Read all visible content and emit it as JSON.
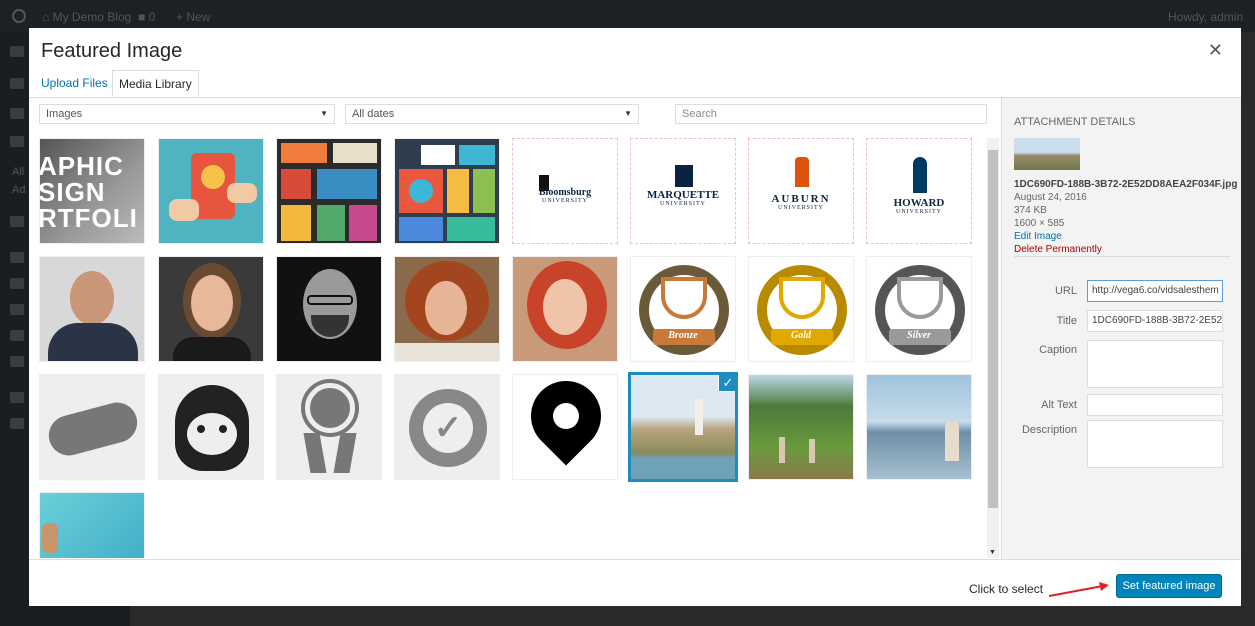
{
  "admin_bar": {
    "site_name": "My Demo Blog",
    "comments_count": "0",
    "new_label": "New",
    "howdy": "Howdy, admin"
  },
  "sidebar": {
    "items": [
      "All",
      "Ad"
    ]
  },
  "modal": {
    "title": "Featured Image",
    "close_icon": "close-icon",
    "tabs": [
      {
        "label": "Upload Files"
      },
      {
        "label": "Media Library"
      }
    ],
    "filters": {
      "type": "Images",
      "date": "All dates",
      "search_placeholder": "Search"
    },
    "thumbnails": [
      {
        "kind": "graphic-design-portfolio",
        "lines": [
          "APHIC",
          "SIGN",
          "RTFOLI"
        ]
      },
      {
        "kind": "tablet-gears-illustration"
      },
      {
        "kind": "retro-icons-grid"
      },
      {
        "kind": "flat-office-icons"
      },
      {
        "kind": "university-logo",
        "line1": "Bloomsburg",
        "line2": "UNIVERSITY"
      },
      {
        "kind": "university-logo",
        "line1": "MARQUETTE",
        "line2": "UNIVERSITY"
      },
      {
        "kind": "university-logo",
        "line1": "AUBURN",
        "line2": "UNIVERSITY"
      },
      {
        "kind": "university-logo",
        "line1": "HOWARD",
        "line2": "UNIVERSITY"
      },
      {
        "kind": "portrait-man-suit"
      },
      {
        "kind": "portrait-woman-smiling"
      },
      {
        "kind": "portrait-man-glasses"
      },
      {
        "kind": "portrait-woman-curly"
      },
      {
        "kind": "portrait-woman-redhair"
      },
      {
        "kind": "trophy-badge",
        "label": "Bronze",
        "color": "#c97a3a"
      },
      {
        "kind": "trophy-badge",
        "label": "Gold",
        "color": "#e0a800"
      },
      {
        "kind": "trophy-badge",
        "label": "Silver",
        "color": "#9a9a9a"
      },
      {
        "kind": "handshake-icon"
      },
      {
        "kind": "support-agent-icon"
      },
      {
        "kind": "award-ribbon-icon"
      },
      {
        "kind": "check-badge-icon"
      },
      {
        "kind": "map-pin-icon"
      },
      {
        "kind": "yoga-pool-photo",
        "selected": true
      },
      {
        "kind": "yoga-group-photo"
      },
      {
        "kind": "yoga-lake-photo"
      },
      {
        "kind": "water-photo"
      }
    ],
    "details": {
      "heading": "Attachment Details",
      "filename": "1DC690FD-188B-3B72-2E52DD8AEA2F034F.jpg",
      "date": "August 24, 2016",
      "size": "374 KB",
      "dimensions": "1600 × 585",
      "edit_link": "Edit Image",
      "delete_link": "Delete Permanently",
      "fields": {
        "url_label": "URL",
        "url_value": "http://vega6.co/vidsalesthem",
        "title_label": "Title",
        "title_value": "1DC690FD-188B-3B72-2E52D",
        "caption_label": "Caption",
        "alt_label": "Alt Text",
        "description_label": "Description"
      }
    },
    "toolbar": {
      "hint": "Click to select",
      "button": "Set featured image"
    }
  }
}
